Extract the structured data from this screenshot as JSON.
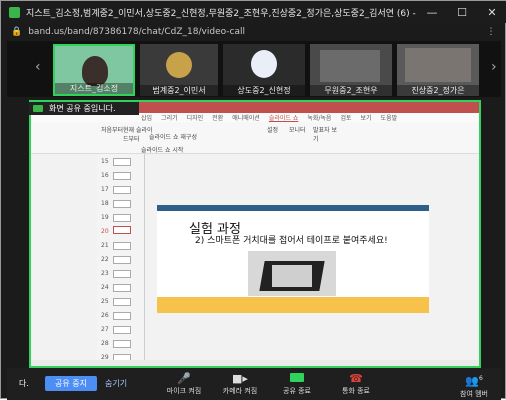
{
  "window": {
    "title": "지스트_김소정,범계중2_이민서,상도중2_신현정,무원중2_조현우,진상중2_정가은,상도중2_김서연 (6) - 밴드모몸...",
    "minimize": "—",
    "maximize": "☐",
    "close": "✕"
  },
  "address": {
    "url": "band.us/band/87386178/chat/CdZ_18/video-call",
    "lock": "🔒",
    "menu": "⋮"
  },
  "participants": [
    {
      "name": "지스트_김소정"
    },
    {
      "name": "범계중2_이민서"
    },
    {
      "name": "상도중2_신현정"
    },
    {
      "name": "무원중2_조현우"
    },
    {
      "name": "진상중2_정가은"
    }
  ],
  "strip": {
    "prev": "‹",
    "next": "›"
  },
  "banner": {
    "text": "화면 공유 중입니다."
  },
  "ppt": {
    "tabs": [
      "삽입",
      "그리기",
      "디자인",
      "전환",
      "애니메이션",
      "슬라이드 쇼",
      "녹화/녹음",
      "검토",
      "보기",
      "도움말"
    ],
    "ribbon": [
      "처음부터",
      "현재 슬라이드부터",
      "슬라이드 쇼 재구성",
      "설정",
      "모니터",
      "발표자 보기"
    ],
    "group": "슬라이드 쇼 시작",
    "thumb_numbers": [
      "15",
      "16",
      "17",
      "18",
      "19",
      "20",
      "21",
      "22",
      "23",
      "24",
      "25",
      "26",
      "27",
      "28",
      "29"
    ],
    "slide": {
      "heading": "실험 과정",
      "subtext": "2) 스마트폰 거치대를 접어서 테이프로 붙여주세요!"
    }
  },
  "toolbar": {
    "sharing": "다.",
    "stop_share": "공유 중지",
    "hide": "숨기기",
    "mic": "마이크 켜짐",
    "camera": "카메라 켜짐",
    "share": "공유 종료",
    "end": "통화 종료",
    "participants": "참여 멤버",
    "participants_count": "6"
  },
  "colors": {
    "accent_green": "#2fd25a",
    "blue": "#4d8ef5",
    "end_red": "#e0443a",
    "ppt_red": "#c0504d"
  }
}
